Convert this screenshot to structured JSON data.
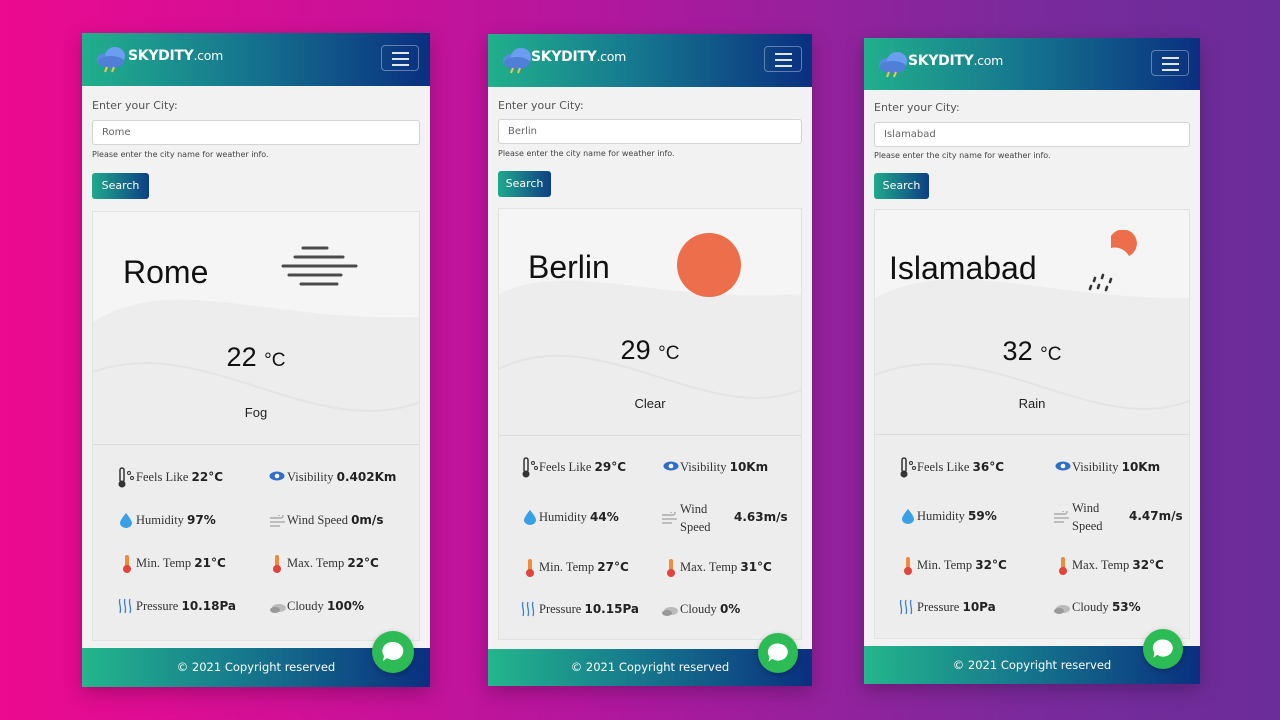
{
  "brand": {
    "name": "SKYDITY",
    "domain": ".com"
  },
  "form": {
    "label": "Enter your City:",
    "help": "Please enter the city name for weather info.",
    "search_label": "Search"
  },
  "footer": {
    "text": "© 2021 Copyright reserved"
  },
  "stat_labels": {
    "feels": "Feels Like",
    "visibility": "Visibility",
    "humidity": "Humidity",
    "wind": "Wind Speed",
    "wind_line1": "Wind",
    "wind_line2": "Speed",
    "min": "Min. Temp",
    "max": "Max. Temp",
    "pressure": "Pressure",
    "cloudy": "Cloudy"
  },
  "colors": {
    "nav_start": "#21b08c",
    "nav_end": "#0a2f80",
    "sun": "#ec6e4a",
    "chat": "#2dbb55"
  },
  "cards": [
    {
      "city_input": "Rome",
      "city": "Rome",
      "temp": "22",
      "unit": "°C",
      "condition": "Fog",
      "icon": "fog-icon",
      "feels": "22°C",
      "visibility": "0.402Km",
      "humidity": "97%",
      "wind": "0m/s",
      "min": "21°C",
      "max": "22°C",
      "pressure": "10.18Pa",
      "cloudy": "100%"
    },
    {
      "city_input": "Berlin",
      "city": "Berlin",
      "temp": "29",
      "unit": "°C",
      "condition": "Clear",
      "icon": "sun-icon",
      "feels": "29°C",
      "visibility": "10Km",
      "humidity": "44%",
      "wind": "4.63m/s",
      "min": "27°C",
      "max": "31°C",
      "pressure": "10.15Pa",
      "cloudy": "0%"
    },
    {
      "city_input": "Islamabad",
      "city": "Islamabad",
      "temp": "32",
      "unit": "°C",
      "condition": "Rain",
      "icon": "rain-icon",
      "feels": "36°C",
      "visibility": "10Km",
      "humidity": "59%",
      "wind": "4.47m/s",
      "min": "32°C",
      "max": "32°C",
      "pressure": "10Pa",
      "cloudy": "53%"
    }
  ]
}
